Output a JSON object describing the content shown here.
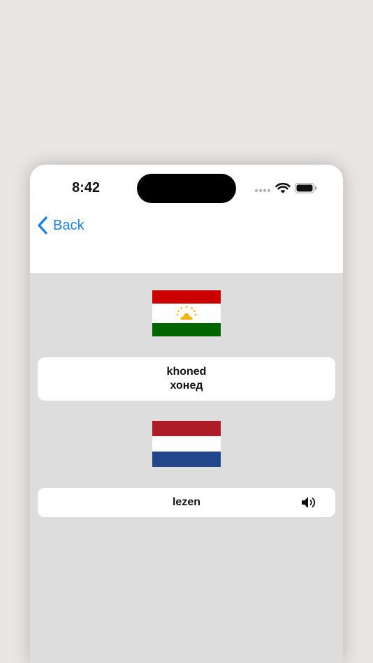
{
  "status_bar": {
    "time": "8:42"
  },
  "nav": {
    "back_label": "Back"
  },
  "source": {
    "flag": "tajikistan-flag",
    "transliteration": "khoned",
    "word": "хонед"
  },
  "target": {
    "flag": "netherlands-flag",
    "word": "lezen",
    "audio_icon": "speaker-icon"
  },
  "colors": {
    "accent": "#1a7ee6",
    "content_background": "#dddddd",
    "card_background": "#ffffff"
  }
}
